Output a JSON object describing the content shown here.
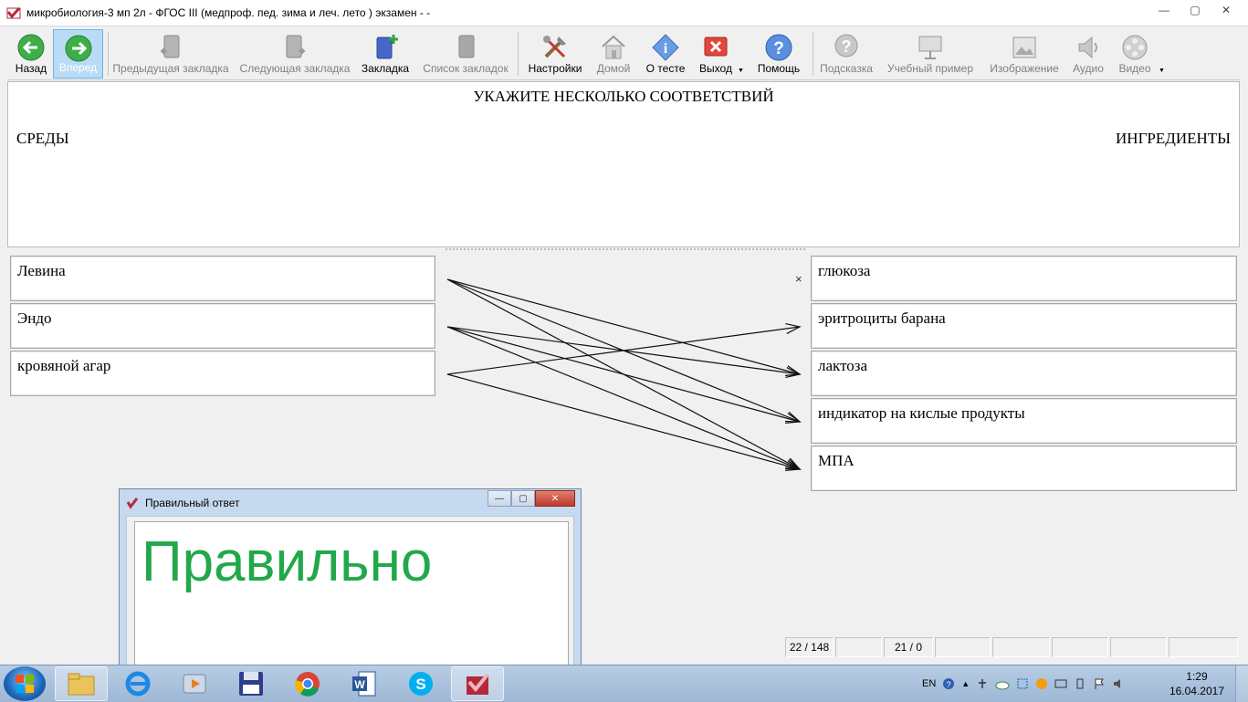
{
  "window": {
    "title": "микробиология-3 мп 2л - ФГОС III (медпроф. пед. зима и леч. лето ) экзамен -  -",
    "min": "—",
    "max": "▢",
    "close": "✕"
  },
  "toolbar": {
    "back": "Назад",
    "forward": "Вперед",
    "prev_bookmark": "Предыдущая закладка",
    "next_bookmark": "Следующая закладка",
    "bookmark": "Закладка",
    "bookmark_list": "Список закладок",
    "settings": "Настройки",
    "home": "Домой",
    "about": "О тесте",
    "exit": "Выход",
    "help": "Помощь",
    "hint": "Подсказка",
    "example": "Учебный пример",
    "image": "Изображение",
    "audio": "Аудио",
    "video": "Видео"
  },
  "question": {
    "heading": "УКАЖИТЕ НЕСКОЛЬКО СООТВЕТСТВИЙ",
    "left_header": "СРЕДЫ",
    "right_header": "ИНГРЕДИЕНТЫ"
  },
  "left_items": [
    "Левина",
    "Эндо",
    "кровяной агар"
  ],
  "right_items": [
    "глюкоза",
    "эритроциты барана",
    "лактоза",
    "индикатор на кислые продукты",
    "МПА"
  ],
  "connections": [
    [
      0,
      2
    ],
    [
      0,
      3
    ],
    [
      0,
      4
    ],
    [
      1,
      2
    ],
    [
      1,
      3
    ],
    [
      1,
      4
    ],
    [
      2,
      1
    ],
    [
      2,
      4
    ]
  ],
  "remove_mark": "×",
  "status": {
    "progress": "22 / 148",
    "score": "21 / 0"
  },
  "popup": {
    "title": "Правильный ответ",
    "result": "Правильно",
    "result_color": "#22a84a"
  },
  "taskbar": {
    "lang": "EN",
    "time": "1:29",
    "date": "16.04.2017"
  }
}
